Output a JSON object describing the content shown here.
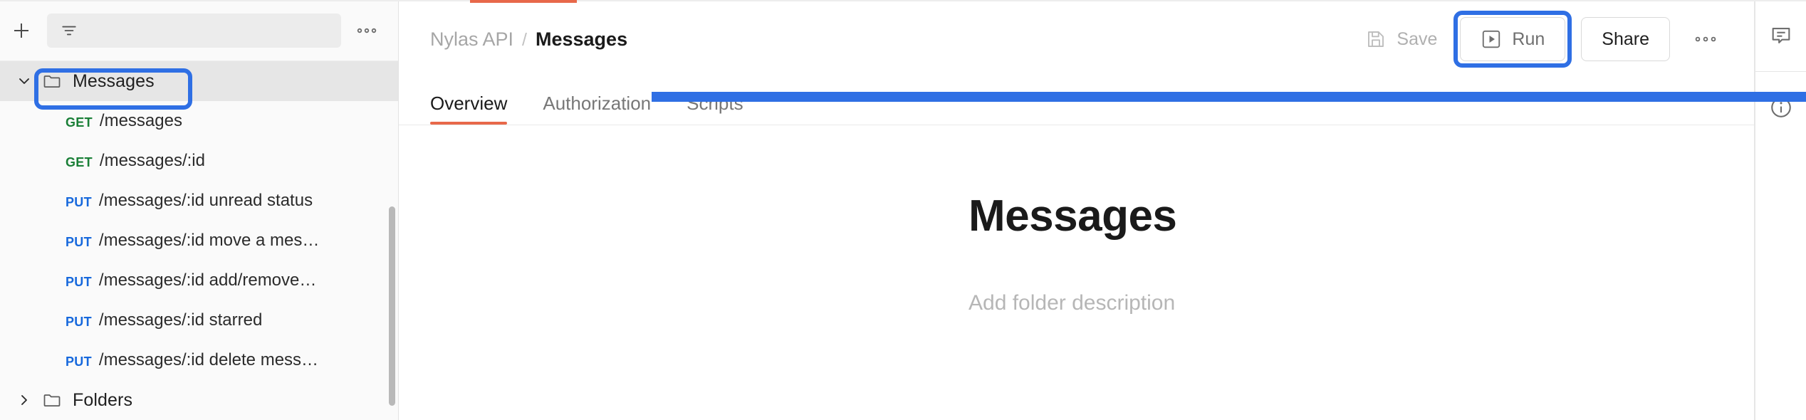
{
  "sidebar": {
    "add_button": "+",
    "filter": {
      "placeholder": "",
      "value": "",
      "icon": "filter-icon"
    },
    "more_menu": "•••",
    "tree": [
      {
        "type": "folder",
        "label": "Messages",
        "expanded": true,
        "selected": true,
        "highlighted": true,
        "chevron": "chevron-down",
        "children": [
          {
            "verb": "GET",
            "path": "/messages"
          },
          {
            "verb": "GET",
            "path": "/messages/:id"
          },
          {
            "verb": "PUT",
            "path": "/messages/:id unread status"
          },
          {
            "verb": "PUT",
            "path": "/messages/:id move a mes…"
          },
          {
            "verb": "PUT",
            "path": "/messages/:id add/remove…"
          },
          {
            "verb": "PUT",
            "path": "/messages/:id starred"
          },
          {
            "verb": "PUT",
            "path": "/messages/:id delete mess…"
          }
        ]
      },
      {
        "type": "folder",
        "label": "Folders",
        "expanded": false,
        "selected": false,
        "highlighted": false,
        "chevron": "chevron-right",
        "children": []
      }
    ]
  },
  "header": {
    "breadcrumb": {
      "parent": "Nylas API",
      "separator": "/",
      "current": "Messages"
    },
    "actions": {
      "save_label": "Save",
      "run_label": "Run",
      "share_label": "Share",
      "more_label": "•••"
    }
  },
  "tabs": [
    {
      "label": "Overview",
      "active": true
    },
    {
      "label": "Authorization",
      "active": false
    },
    {
      "label": "Scripts",
      "active": false
    }
  ],
  "main": {
    "title": "Messages",
    "description_placeholder": "Add folder description"
  },
  "right_rail": [
    {
      "icon": "comment-icon",
      "label": "Comments"
    },
    {
      "icon": "info-icon",
      "label": "Documentation"
    }
  ],
  "annotations": {
    "highlight_color": "#2f6fe4",
    "arrow_color": "#2f6fe4",
    "targets": [
      "Messages folder",
      "Run button"
    ]
  },
  "colors": {
    "verb_get": "#1a7f37",
    "verb_put": "#1668dc",
    "active_tab_underline": "#e8684a",
    "annotation_blue": "#2f6fe4",
    "sidebar_bg": "#fafafa",
    "selected_row_bg": "#e6e6e6"
  }
}
